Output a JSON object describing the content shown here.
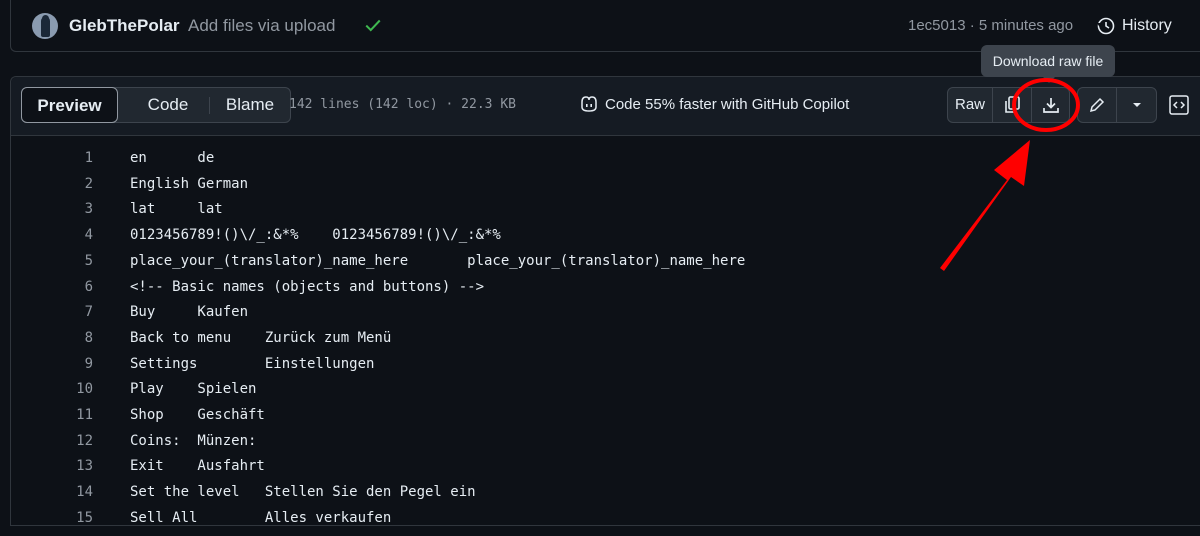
{
  "commit": {
    "author": "GlebThePolar",
    "message": "Add files via upload",
    "sha_time": "1ec5013 · 5 minutes ago",
    "history_label": "History"
  },
  "file_header": {
    "tabs": [
      "Preview",
      "Code",
      "Blame"
    ],
    "meta": "142 lines (142 loc) · 22.3 KB",
    "copilot": "Code 55% faster with GitHub Copilot",
    "raw_label": "Raw",
    "tooltip": "Download raw file"
  },
  "lines": [
    {
      "n": "1",
      "t": "en      de"
    },
    {
      "n": "2",
      "t": "English German"
    },
    {
      "n": "3",
      "t": "lat     lat"
    },
    {
      "n": "4",
      "t": "0123456789!()\\/_:&*%    0123456789!()\\/_:&*%"
    },
    {
      "n": "5",
      "t": "place_your_(translator)_name_here       place_your_(translator)_name_here"
    },
    {
      "n": "6",
      "t": "<!-- Basic names (objects and buttons) -->"
    },
    {
      "n": "7",
      "t": "Buy     Kaufen"
    },
    {
      "n": "8",
      "t": "Back to menu    Zurück zum Menü"
    },
    {
      "n": "9",
      "t": "Settings        Einstellungen"
    },
    {
      "n": "10",
      "t": "Play    Spielen"
    },
    {
      "n": "11",
      "t": "Shop    Geschäft"
    },
    {
      "n": "12",
      "t": "Coins:  Münzen:"
    },
    {
      "n": "13",
      "t": "Exit    Ausfahrt"
    },
    {
      "n": "14",
      "t": "Set the level   Stellen Sie den Pegel ein"
    },
    {
      "n": "15",
      "t": "Sell All        Alles verkaufen"
    }
  ],
  "colors": {
    "background": "#0d1117",
    "header": "#151b23",
    "border": "#30363d",
    "success": "#3fb950",
    "annotation": "#ff0000"
  }
}
